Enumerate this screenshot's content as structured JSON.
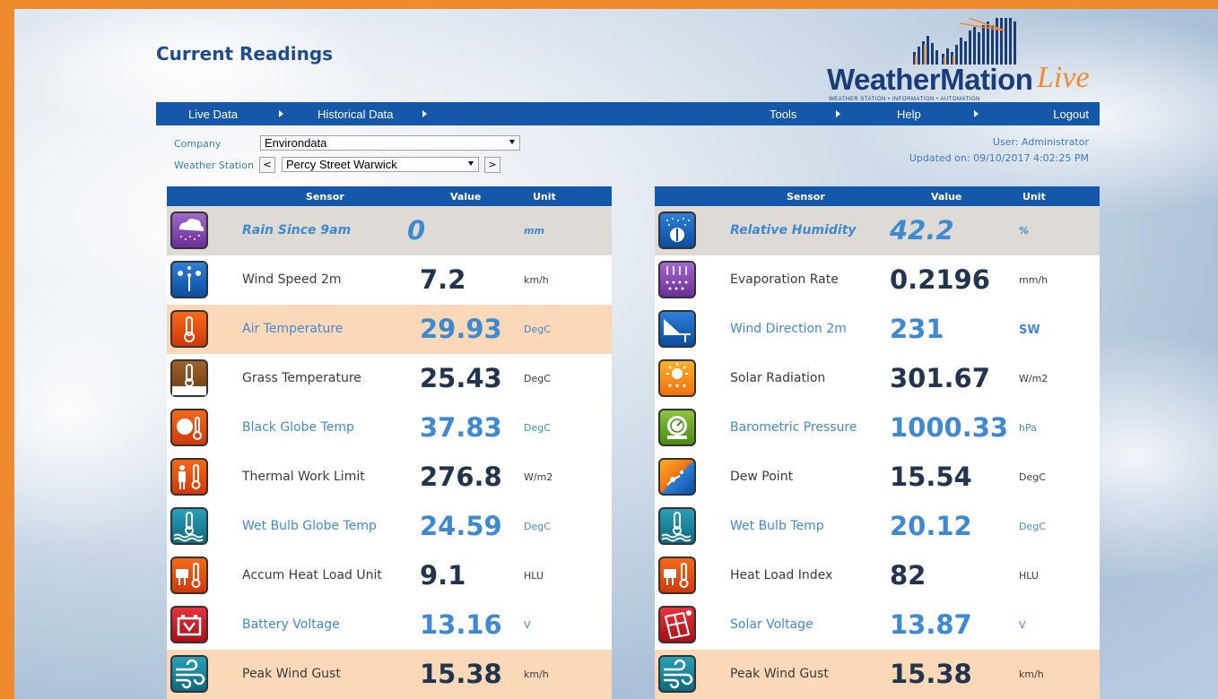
{
  "page": {
    "title": "Current Readings"
  },
  "logo": {
    "main": "WeatherMation",
    "live": "Live",
    "sub": "WEATHER STATION • INFORMATION • AUTOMATION"
  },
  "nav": {
    "live_data": "Live Data",
    "historical_data": "Historical Data",
    "tools": "Tools",
    "help": "Help",
    "logout": "Logout"
  },
  "form": {
    "company_label": "Company",
    "company_value": "Environdata",
    "station_label": "Weather Station",
    "station_value": "Percy Street Warwick",
    "prev": "<",
    "next": ">"
  },
  "user": {
    "user_text": "User: Administrator",
    "updated_text": "Updated on: 09/10/2017 4:02:25 PM"
  },
  "table_headers": {
    "sensor": "Sensor",
    "value": "Value",
    "unit": "Unit"
  },
  "left_rows": [
    {
      "sensor": "Rain Since 9am",
      "value": "0",
      "unit": "mm",
      "icon": "rain-icon"
    },
    {
      "sensor": "Wind Speed 2m",
      "value": "7.2",
      "unit": "km/h",
      "icon": "anemometer-icon"
    },
    {
      "sensor": "Air Temperature",
      "value": "29.93",
      "unit": "DegC",
      "icon": "thermometer-icon"
    },
    {
      "sensor": "Grass Temperature",
      "value": "25.43",
      "unit": "DegC",
      "icon": "grass-thermometer-icon"
    },
    {
      "sensor": "Black Globe Temp",
      "value": "37.83",
      "unit": "DegC",
      "icon": "globe-thermometer-icon"
    },
    {
      "sensor": "Thermal Work Limit",
      "value": "276.8",
      "unit": "W/m2",
      "icon": "worker-thermometer-icon"
    },
    {
      "sensor": "Wet Bulb Globe Temp",
      "value": "24.59",
      "unit": "DegC",
      "icon": "wet-bulb-icon"
    },
    {
      "sensor": "Accum Heat Load Unit",
      "value": "9.1",
      "unit": "HLU",
      "icon": "cattle-heat-icon"
    },
    {
      "sensor": "Battery Voltage",
      "value": "13.16",
      "unit": "V",
      "icon": "battery-icon"
    },
    {
      "sensor": "Peak Wind Gust",
      "value": "15.38",
      "unit": "km/h",
      "icon": "wind-gust-icon"
    }
  ],
  "right_rows": [
    {
      "sensor": "Relative Humidity",
      "value": "42.2",
      "unit": "%",
      "icon": "humidity-icon"
    },
    {
      "sensor": "Evaporation Rate",
      "value": "0.2196",
      "unit": "mm/h",
      "icon": "evaporation-icon"
    },
    {
      "sensor": "Wind Direction 2m",
      "value": "231",
      "unit": "SW",
      "icon": "wind-direction-icon"
    },
    {
      "sensor": "Solar Radiation",
      "value": "301.67",
      "unit": "W/m2",
      "icon": "sun-icon"
    },
    {
      "sensor": "Barometric Pressure",
      "value": "1000.33",
      "unit": "hPa",
      "icon": "barometer-icon"
    },
    {
      "sensor": "Dew Point",
      "value": "15.54",
      "unit": "DegC",
      "icon": "dew-point-icon"
    },
    {
      "sensor": "Wet Bulb Temp",
      "value": "20.12",
      "unit": "DegC",
      "icon": "wet-bulb-icon"
    },
    {
      "sensor": "Heat Load Index",
      "value": "82",
      "unit": "HLU",
      "icon": "cattle-heat-icon"
    },
    {
      "sensor": "Solar Voltage",
      "value": "13.87",
      "unit": "V",
      "icon": "solar-panel-icon"
    },
    {
      "sensor": "Peak Wind Gust",
      "value": "15.38",
      "unit": "km/h",
      "icon": "wind-gust-icon"
    }
  ],
  "colors": {
    "nav_blue": "#1557a8",
    "orange_border": "#f08a2e",
    "light_text_blue": "#3e8ad2",
    "dark_value": "#22354f",
    "row_gray": "#dedad5",
    "row_peach": "#fbd9b8"
  }
}
